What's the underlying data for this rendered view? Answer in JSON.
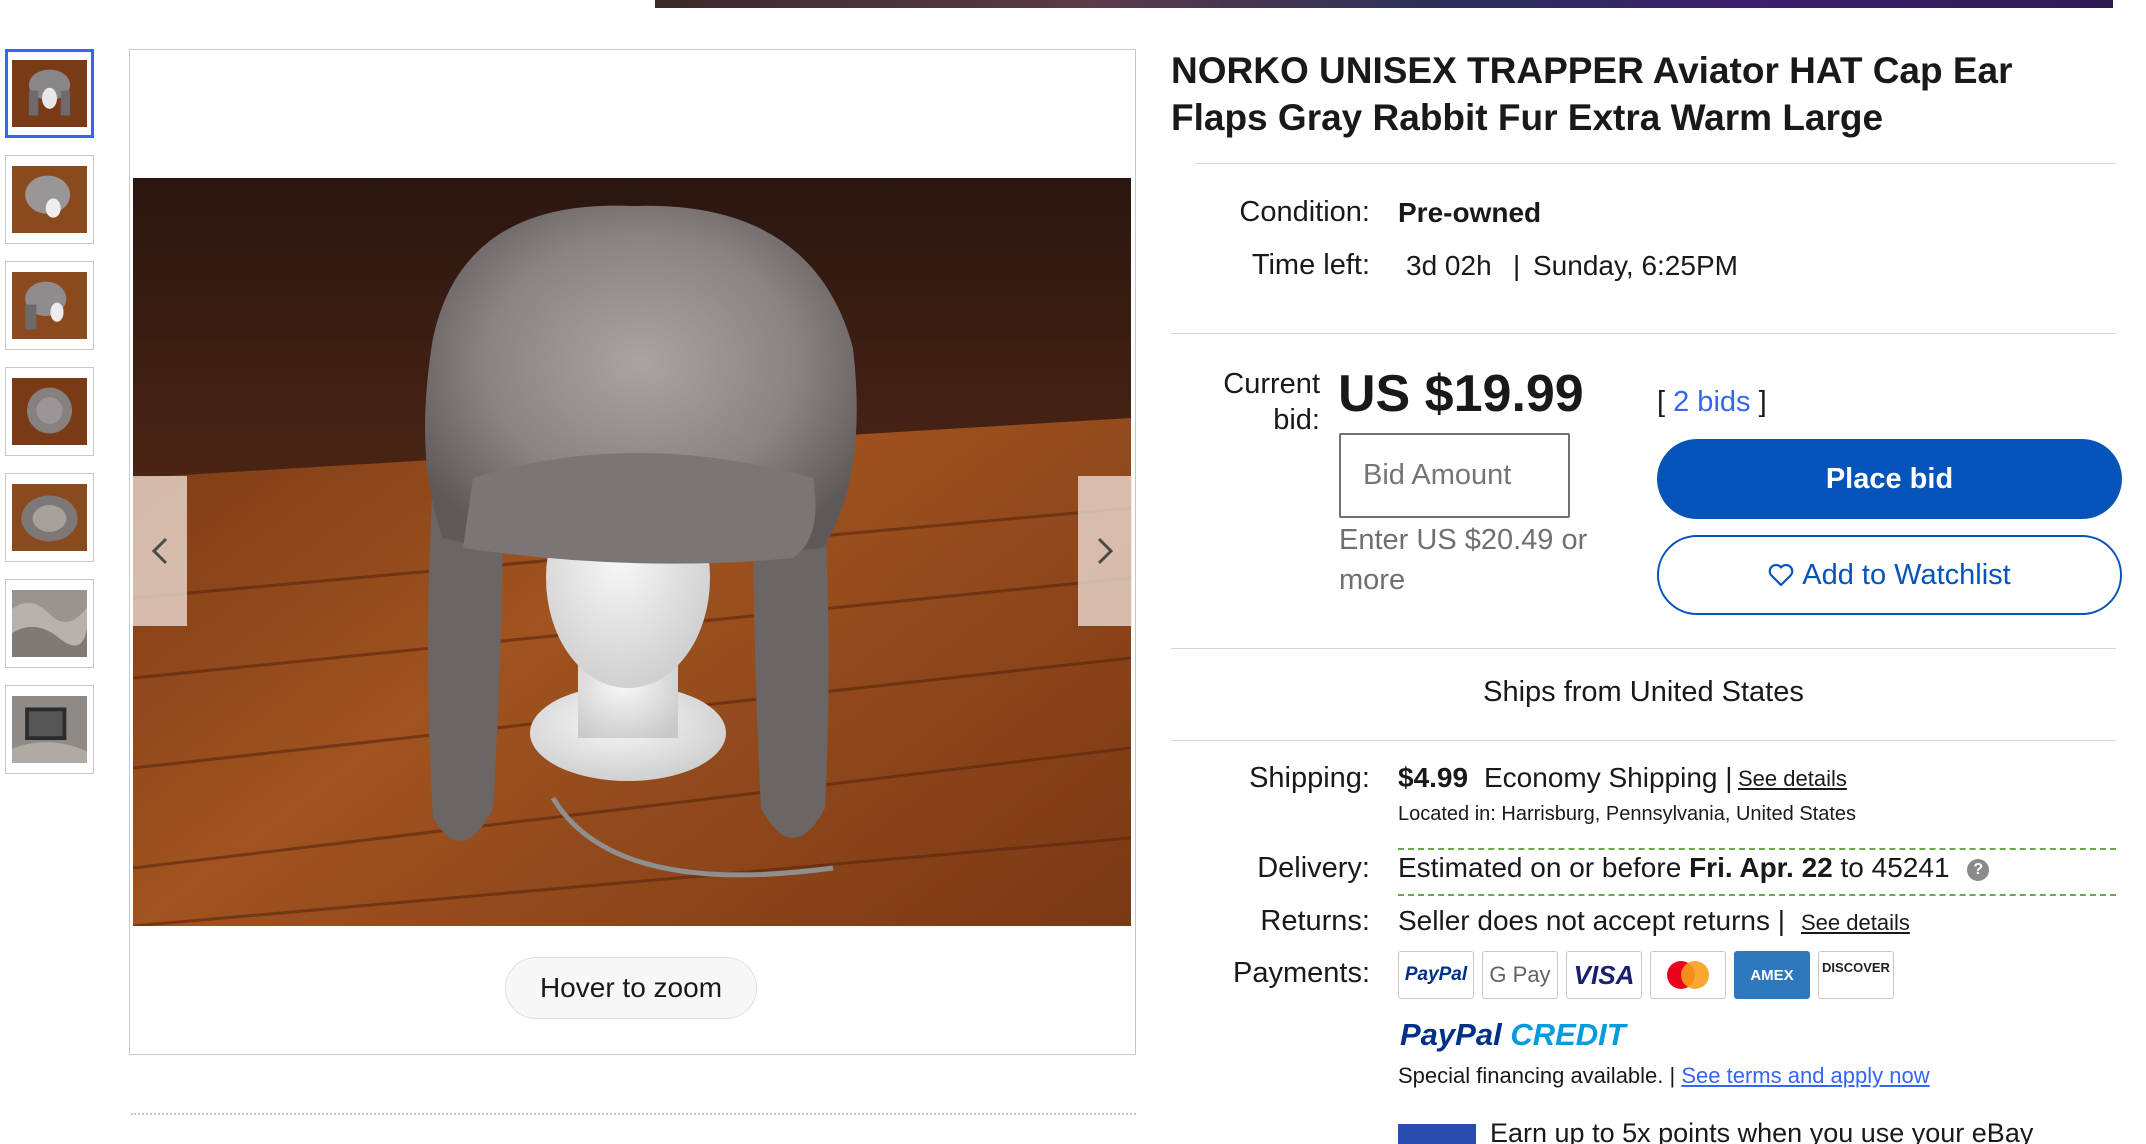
{
  "listing": {
    "title": "NORKO UNISEX TRAPPER Aviator HAT Cap Ear Flaps Gray Rabbit Fur Extra Warm Large",
    "condition_label": "Condition:",
    "condition_value": "Pre-owned",
    "time_left_label": "Time left:",
    "time_left_value": "3d 02h",
    "time_sep": "|",
    "end_time": "Sunday, 6:25PM"
  },
  "gallery": {
    "hover_zoom": "Hover to zoom",
    "thumbnail_count": 7,
    "active_index": 0
  },
  "bid": {
    "current_label_1": "Current",
    "current_label_2": "bid:",
    "price": "US $19.99",
    "bids_open": "[",
    "bids_link": "2 bids",
    "bids_close": "]",
    "input_placeholder": "Bid Amount",
    "hint": "Enter US $20.49 or more",
    "place_bid": "Place bid",
    "watchlist": "Add to Watchlist"
  },
  "shipping": {
    "ships_from": "Ships from United States",
    "shipping_label": "Shipping:",
    "shipping_price": "$4.99",
    "shipping_method": "Economy Shipping |",
    "see_details": "See details",
    "located_label": "Located in:",
    "located_value": "Harrisburg, Pennsylvania, United States",
    "delivery_label": "Delivery:",
    "delivery_prefix": "Estimated on or before",
    "delivery_date": "Fri. Apr. 22",
    "delivery_suffix": "to 45241",
    "returns_label": "Returns:",
    "returns_value": "Seller does not accept returns |",
    "returns_details": "See details",
    "payments_label": "Payments:"
  },
  "payments": {
    "methods": [
      "PayPal",
      "G Pay",
      "VISA",
      "Mastercard",
      "AMEX",
      "DISCOVER"
    ],
    "paypal_credit_pay": "PayPal",
    "paypal_credit_credit": "CREDIT",
    "special_financing": "Special financing available. |",
    "terms_link": "See terms and apply now",
    "earn_text": "Earn up to 5x points when you use your eBay"
  },
  "colors": {
    "primary_blue": "#0654ba",
    "link_blue": "#3665f3",
    "delivery_dash": "#6aa84f"
  }
}
